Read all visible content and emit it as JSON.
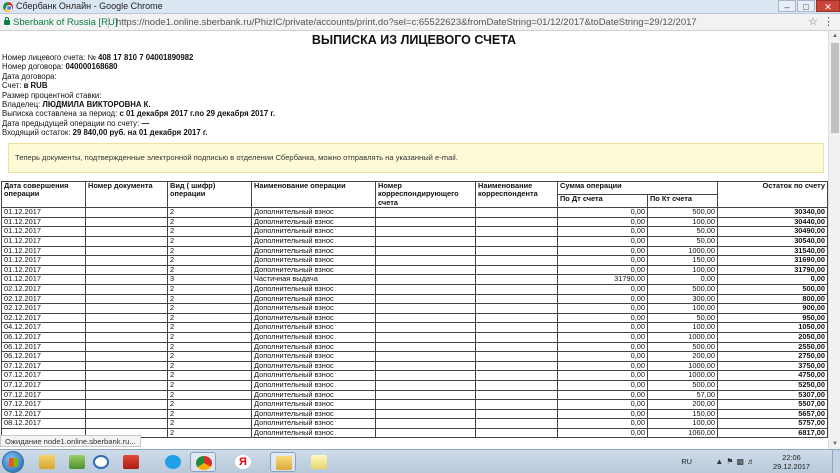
{
  "window": {
    "title": "Сбербанк Онлайн - Google Chrome"
  },
  "addressbar": {
    "security_label": "Sberbank of Russia [RU]",
    "url": "https://node1.online.sberbank.ru/PhizIC/private/accounts/print.do?sel=c:65522623&fromDateString=01/12/2017&toDateString=29/12/2017"
  },
  "document": {
    "cut_text": "~~ ~~~~~~~",
    "title": "ВЫПИСКА ИЗ ЛИЦЕВОГО СЧЕТА",
    "fields": [
      {
        "label": "Номер лицевого счета: №",
        "value": "408 17 810 7 04001890982"
      },
      {
        "label": "Номер договора:",
        "value": "040000168680"
      },
      {
        "label": "Дата договора:",
        "value": ""
      },
      {
        "label": "Счет:",
        "value": "в RUB"
      },
      {
        "label": "Размер процентной ставки:",
        "value": ""
      },
      {
        "label": "Владелец:",
        "value": "ЛЮДМИЛА ВИКТОРОВНА К."
      },
      {
        "label": "Выписка составлена за период:",
        "value": "с 01 декабря 2017 г.по 29 декабря 2017 г."
      },
      {
        "label": "Дата предыдущей операции по счету:",
        "value": "—"
      },
      {
        "label": "Входящий остаток:",
        "value": "29 840,00 руб. на 01 декабря 2017 г."
      }
    ],
    "notice": "Теперь документы, подтвержденные электронной подписью в отделении Сбербанка, можно отправлять на указанный e-mail."
  },
  "table": {
    "headers": {
      "date": "Дата совершения операции",
      "doc_no": "Номер документа",
      "code": "Вид ( шифр) операции",
      "name": "Наименование операции",
      "corr_account": "Номер корреспондирующего счета",
      "corr_name": "Наименование корреспондента",
      "sum": "Сумма операции",
      "debit": "По Дт счета",
      "credit": "По Кт счета",
      "balance": "Остаток по счету"
    },
    "rows": [
      [
        "01.12.2017",
        "",
        "2",
        "Дополнительный взнос",
        "",
        "",
        "0,00",
        "500,00",
        "30340,00"
      ],
      [
        "01.12.2017",
        "",
        "2",
        "Дополнительный взнос",
        "",
        "",
        "0,00",
        "100,00",
        "30440,00"
      ],
      [
        "01.12.2017",
        "",
        "2",
        "Дополнительный взнос",
        "",
        "",
        "0,00",
        "50,00",
        "30490,00"
      ],
      [
        "01.12.2017",
        "",
        "2",
        "Дополнительный взнос",
        "",
        "",
        "0,00",
        "50,00",
        "30540,00"
      ],
      [
        "01.12.2017",
        "",
        "2",
        "Дополнительный взнос",
        "",
        "",
        "0,00",
        "1000,00",
        "31540,00"
      ],
      [
        "01.12.2017",
        "",
        "2",
        "Дополнительный взнос",
        "",
        "",
        "0,00",
        "150,00",
        "31690,00"
      ],
      [
        "01.12.2017",
        "",
        "2",
        "Дополнительный взнос",
        "",
        "",
        "0,00",
        "100,00",
        "31790,00"
      ],
      [
        "01.12.2017",
        "",
        "3",
        "Частичная выдача",
        "",
        "",
        "31790,00",
        "0,00",
        "0,00"
      ],
      [
        "02.12.2017",
        "",
        "2",
        "Дополнительный взнос",
        "",
        "",
        "0,00",
        "500,00",
        "500,00"
      ],
      [
        "02.12.2017",
        "",
        "2",
        "Дополнительный взнос",
        "",
        "",
        "0,00",
        "300,00",
        "800,00"
      ],
      [
        "02.12.2017",
        "",
        "2",
        "Дополнительный взнос",
        "",
        "",
        "0,00",
        "100,00",
        "900,00"
      ],
      [
        "02.12.2017",
        "",
        "2",
        "Дополнительный взнос",
        "",
        "",
        "0,00",
        "50,00",
        "950,00"
      ],
      [
        "04.12.2017",
        "",
        "2",
        "Дополнительный взнос",
        "",
        "",
        "0,00",
        "100,00",
        "1050,00"
      ],
      [
        "06.12.2017",
        "",
        "2",
        "Дополнительный взнос",
        "",
        "",
        "0,00",
        "1000,00",
        "2050,00"
      ],
      [
        "06.12.2017",
        "",
        "2",
        "Дополнительный взнос",
        "",
        "",
        "0,00",
        "500,00",
        "2550,00"
      ],
      [
        "06.12.2017",
        "",
        "2",
        "Дополнительный взнос",
        "",
        "",
        "0,00",
        "200,00",
        "2750,00"
      ],
      [
        "07.12.2017",
        "",
        "2",
        "Дополнительный взнос",
        "",
        "",
        "0,00",
        "1000,00",
        "3750,00"
      ],
      [
        "07.12.2017",
        "",
        "2",
        "Дополнительный взнос",
        "",
        "",
        "0,00",
        "1000,00",
        "4750,00"
      ],
      [
        "07.12.2017",
        "",
        "2",
        "Дополнительный взнос",
        "",
        "",
        "0,00",
        "500,00",
        "5250,00"
      ],
      [
        "07.12.2017",
        "",
        "2",
        "Дополнительный взнос",
        "",
        "",
        "0,00",
        "57,00",
        "5307,00"
      ],
      [
        "07.12.2017",
        "",
        "2",
        "Дополнительный взнос",
        "",
        "",
        "0,00",
        "200,00",
        "5507,00"
      ],
      [
        "07.12.2017",
        "",
        "2",
        "Дополнительный взнос",
        "",
        "",
        "0,00",
        "150,00",
        "5657,00"
      ],
      [
        "08.12.2017",
        "",
        "2",
        "Дополнительный взнос",
        "",
        "",
        "0,00",
        "100,00",
        "5757,00"
      ],
      [
        "",
        "",
        "2",
        "Дополнительный взнос",
        "",
        "",
        "0,00",
        "1060,00",
        "6817,00"
      ]
    ]
  },
  "status_bar": {
    "text": "Ожидание node1.online.sberbank.ru..."
  },
  "taskbar": {
    "apps": [
      "start-icon",
      "explorer-icon",
      "d-app-icon",
      "pdf-icon",
      "skype-icon",
      "chrome-icon",
      "yandex-icon",
      "folder-icon",
      "notes-icon"
    ],
    "language": "RU",
    "time": "22:06",
    "date": "29.12.2017"
  },
  "colors": {
    "notice_bg": "#fdfad7",
    "security_green": "#0b8043",
    "taskbar": "#c3d3e3"
  }
}
